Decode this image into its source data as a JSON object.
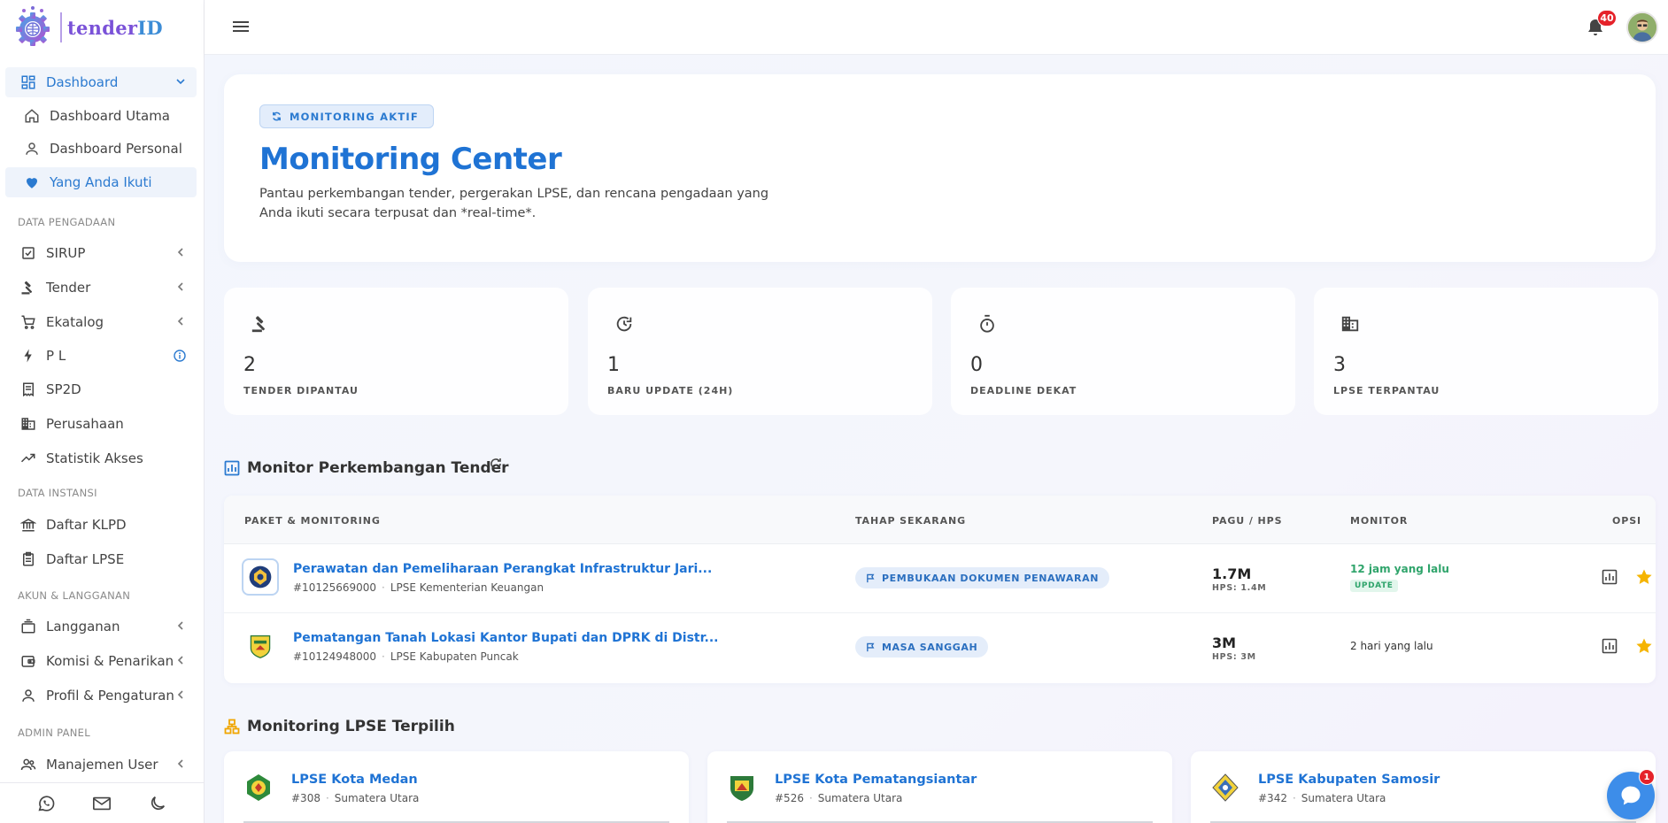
{
  "brand": {
    "name_main": "tender",
    "name_accent": "ID"
  },
  "nav": {
    "dashboard": "Dashboard",
    "dashboard_utama": "Dashboard Utama",
    "dashboard_personal": "Dashboard Personal",
    "yang_anda_ikuti": "Yang Anda Ikuti",
    "section_pengadaan": "DATA PENGADAAN",
    "sirup": "SIRUP",
    "tender": "Tender",
    "ekatalog": "Ekatalog",
    "pl": "P L",
    "sp2d": "SP2D",
    "perusahaan": "Perusahaan",
    "statistik": "Statistik Akses",
    "section_instansi": "DATA INSTANSI",
    "klpd": "Daftar KLPD",
    "lpse": "Daftar LPSE",
    "section_akun": "AKUN & LANGGANAN",
    "langganan": "Langganan",
    "komisi": "Komisi & Penarikan",
    "profil": "Profil & Pengaturan",
    "section_admin": "ADMIN PANEL",
    "manajemen": "Manajemen User"
  },
  "topbar": {
    "notif_count": "40"
  },
  "hero": {
    "pill": "MONITORING AKTIF",
    "title": "Monitoring Center",
    "desc_line1": "Pantau perkembangan tender, pergerakan LPSE, dan rencana pengadaan yang",
    "desc_line2": "Anda ikuti secara terpusat dan *real-time*."
  },
  "stats": [
    {
      "value": "2",
      "label": "TENDER DIPANTAU",
      "icon": "gavel-icon"
    },
    {
      "value": "1",
      "label": "BARU UPDATE (24H)",
      "icon": "history-icon"
    },
    {
      "value": "0",
      "label": "DEADLINE DEKAT",
      "icon": "timer-icon"
    },
    {
      "value": "3",
      "label": "LPSE TERPANTAU",
      "icon": "building-icon"
    }
  ],
  "tender_section": {
    "title": "Monitor Perkembangan Tender",
    "headers": {
      "paket": "PAKET & MONITORING",
      "tahap": "TAHAP SEKARANG",
      "pagu": "PAGU / HPS",
      "monitor": "MONITOR",
      "opsi": "OPSI"
    },
    "rows": [
      {
        "title": "Perawatan dan Pemeliharaan Perangkat Infrastruktur Jari...",
        "id": "#10125669000",
        "lpse": "LPSE Kementerian Keuangan",
        "stage": "PEMBUKAAN DOKUMEN PENAWARAN",
        "pagu": "1.7M",
        "hps": "HPS: 1.4M",
        "monitor": "12 jam yang lalu",
        "badge": "UPDATE"
      },
      {
        "title": "Pematangan Tanah Lokasi Kantor Bupati dan DPRK di Distr...",
        "id": "#10124948000",
        "lpse": "LPSE Kabupaten Puncak",
        "stage": "MASA SANGGAH",
        "pagu": "3M",
        "hps": "HPS: 3M",
        "monitor": "2 hari yang lalu"
      }
    ]
  },
  "lpse_section": {
    "title": "Monitoring LPSE Terpilih",
    "cards": [
      {
        "name": "LPSE Kota Medan",
        "code": "#308",
        "region": "Sumatera Utara"
      },
      {
        "name": "LPSE Kota Pematangsiantar",
        "code": "#526",
        "region": "Sumatera Utara"
      },
      {
        "name": "LPSE Kabupaten Samosir",
        "code": "#342",
        "region": "Sumatera Utara"
      }
    ]
  },
  "chat": {
    "badge": "1"
  },
  "colors": {
    "primary": "#1f73d4",
    "accent": "#7a52d8",
    "success": "#2fa46b",
    "danger": "#e5222a",
    "star": "#f5b400"
  }
}
